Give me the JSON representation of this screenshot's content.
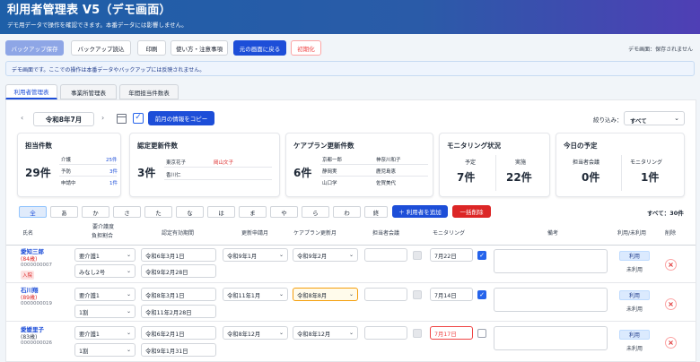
{
  "header": {
    "title": "利用者管理表 V5（デモ画面）",
    "subtitle": "デモ用データで操作を確認できます。本番データには影響しません。"
  },
  "toolbar": {
    "backup_save": "バックアップ保存",
    "backup_load": "バックアップ読込",
    "print": "印刷",
    "usage_notes": "使い方・注意事項",
    "back_to_original": "元の画面に戻る",
    "initialize": "初期化",
    "save_status": "デモ画面：保存されません"
  },
  "notice": "デモ画面です。ここでの操作は本番データやバックアップには反映されません。",
  "tabs": [
    "利用者管理表",
    "事業所管理表",
    "年間担当件数表"
  ],
  "month_nav": {
    "prev": "‹",
    "month": "令和8年7月",
    "next": "›",
    "copy_button": "前月の情報をコピー"
  },
  "filter": {
    "label": "絞り込み：",
    "value": "すべて"
  },
  "cards": {
    "caseload": {
      "title": "担当件数",
      "total": "29件",
      "rows": [
        {
          "label": "介護",
          "value": "25件"
        },
        {
          "label": "予防",
          "value": "3件"
        },
        {
          "label": "申請中",
          "value": "1件"
        }
      ]
    },
    "cert_renewal": {
      "title": "認定更新件数",
      "total": "3件",
      "names": [
        "東京花子",
        "岡山文子",
        "香川仁"
      ]
    },
    "careplan_renewal": {
      "title": "ケアプラン更新件数",
      "total": "6件",
      "names": [
        "京都一郎",
        "神奈川和子",
        "静岡実",
        "鹿児島恵",
        "山口学",
        "佐賀美代"
      ]
    },
    "monitoring": {
      "title": "モニタリング状況",
      "planned_label": "予定",
      "planned": "7件",
      "done_label": "実施",
      "done": "22件"
    },
    "today": {
      "title": "今日の予定",
      "meeting_label": "担当者会議",
      "meeting": "0件",
      "monitoring_label": "モニタリング",
      "monitoring": "1件"
    }
  },
  "kana_filter": [
    "全",
    "あ",
    "か",
    "さ",
    "た",
    "な",
    "は",
    "ま",
    "や",
    "ら",
    "わ",
    "終"
  ],
  "add_user": "＋ 利用者を追加",
  "bulk_delete": "一括削除",
  "total_count": "すべて：30件",
  "columns": {
    "name": "氏名",
    "care_level": "要介護度",
    "burden": "負担割合",
    "cert_period": "認定有効期間",
    "renewal_month": "更新申請月",
    "plan_update_month": "ケアプラン更新月",
    "meeting": "担当者会議",
    "monitoring": "モニタリング",
    "memo": "備考",
    "use_status": "利用/未利用",
    "delete": "削除"
  },
  "rows": [
    {
      "name": "愛知三郎",
      "age": "(84歳)",
      "number": "0000000007",
      "badge": "入院",
      "care_level": "要介護1",
      "burden": "みなし2号",
      "cert_start": "令和6年3月1日",
      "cert_end": "令和9年2月28日",
      "renewal_month": "令和9年1月",
      "plan_month": "令和9年2月",
      "monitoring_date": "7月22日",
      "monitoring_checked": true,
      "use_label": "利用",
      "unuse_label": "未利用"
    },
    {
      "name": "石川翔",
      "age": "(89歳)",
      "number": "0000000019",
      "badge": "",
      "care_level": "要介護1",
      "burden": "1割",
      "cert_start": "令和8年3月1日",
      "cert_end": "令和11年2月28日",
      "renewal_month": "令和11年1月",
      "plan_month": "令和8年8月",
      "monitoring_date": "7月14日",
      "monitoring_checked": true,
      "use_label": "利用",
      "unuse_label": "未利用"
    },
    {
      "name": "愛媛里子",
      "age": "(83歳)",
      "number": "0000000026",
      "badge": "",
      "care_level": "要介護1",
      "burden": "1割",
      "cert_start": "令和6年2月1日",
      "cert_end": "令和9年1月31日",
      "renewal_month": "令和8年12月",
      "plan_month": "令和8年12月",
      "monitoring_date": "7月17日",
      "monitoring_checked": false,
      "use_label": "利用",
      "unuse_label": "未利用"
    }
  ]
}
